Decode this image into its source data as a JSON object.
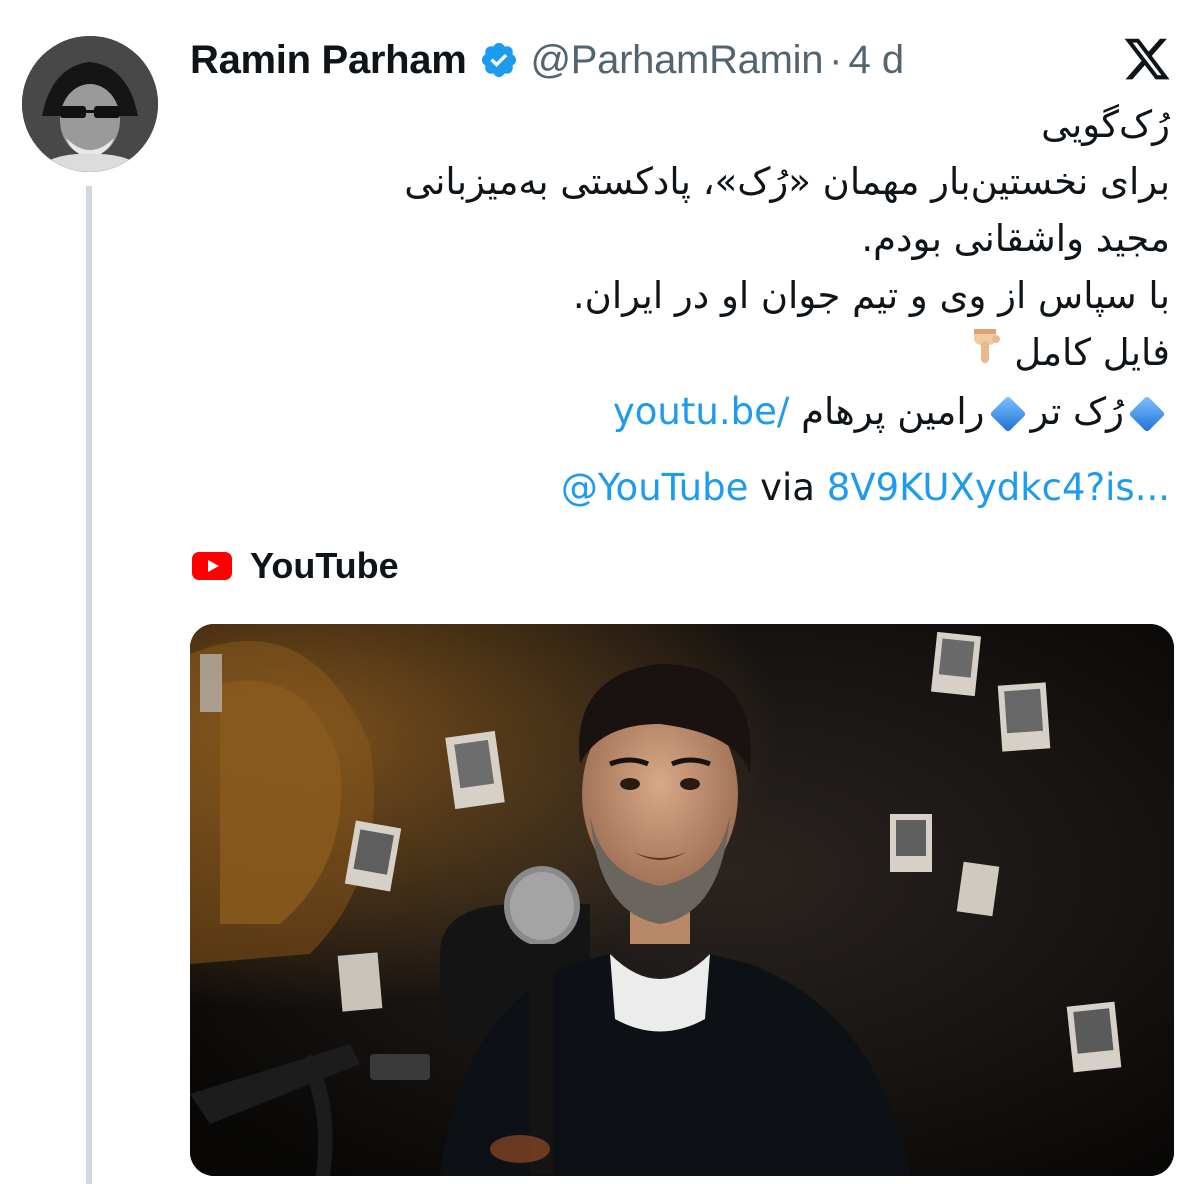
{
  "tweet": {
    "display_name": "Ramin Parham",
    "handle": "@ParhamRamin",
    "separator": "·",
    "time": "4 d",
    "text_lines": [
      "رُک‌گویی",
      "برای نخستین‌بار مهمان «رُک»، پادکستی به‌میزبانی",
      "مجید واشقانی بودم.",
      "با سپاس از وی و تیم جوان او در ایران.",
      "فایل کامل"
    ],
    "link_line": {
      "title_part1": "رُک تر",
      "title_part2": "رامین پرهام",
      "url_start": "youtu.be/"
    },
    "last_line": {
      "mention": "@YouTube",
      "via": "via",
      "url_rest": "8V9KUXydkc4?is..."
    }
  },
  "card": {
    "source_label": "YouTube"
  },
  "icons": {
    "verified": "verified-badge-icon",
    "x_logo": "x-logo-icon",
    "youtube": "youtube-logo-icon",
    "hand": "backhand-index-pointing-down-icon",
    "diamond": "small-blue-diamond-icon"
  },
  "colors": {
    "link": "#1d9bf0",
    "secondary_text": "#536471",
    "verified": "#1d9bf0",
    "youtube_red": "#ff0000"
  }
}
